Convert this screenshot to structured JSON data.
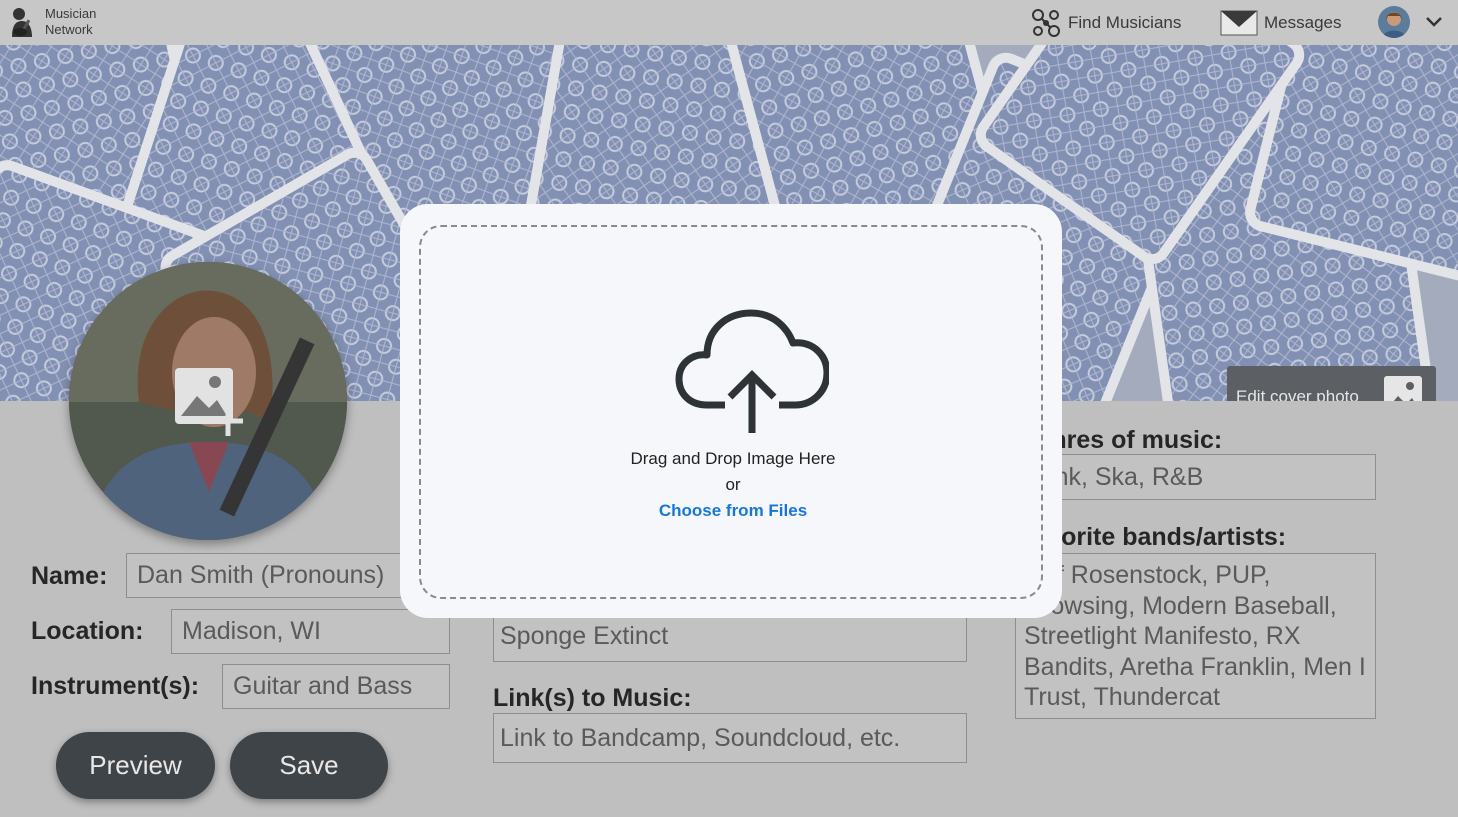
{
  "nav": {
    "logo_line1": "Musician",
    "logo_line2": "Network",
    "find_musicians": "Find Musicians",
    "messages": "Messages"
  },
  "cover": {
    "edit_label": "Edit cover photo"
  },
  "profile": {
    "name_label": "Name:",
    "name_value": "Dan Smith      (Pronouns)",
    "location_label": "Location:",
    "location_value": "Madison, WI",
    "instrument_label": "Instrument(s):",
    "instrument_value": "Guitar and Bass",
    "middle_value": "Sponge Extinct",
    "links_label": "Link(s) to Music:",
    "links_placeholder": "Link to Bandcamp, Soundcloud, etc.",
    "genres_label": "Genres of music:",
    "genres_value": "Punk, Ska, R&B",
    "bands_label": "Favorite bands/artists:",
    "bands_value": "Jeff Rosenstock, PUP, Crowsing, Modern Baseball, Streetlight Manifesto, RX Bandits, Aretha Franklin, Men I Trust, Thundercat"
  },
  "buttons": {
    "preview": "Preview",
    "save": "Save"
  },
  "upload_modal": {
    "drag_text": "Drag and Drop Image Here",
    "or_text": "or",
    "choose_link": "Choose from Files"
  },
  "colors": {
    "button_bg": "#3f4449",
    "link_blue": "#1877d6",
    "cover_card": "#6d7fb0"
  }
}
